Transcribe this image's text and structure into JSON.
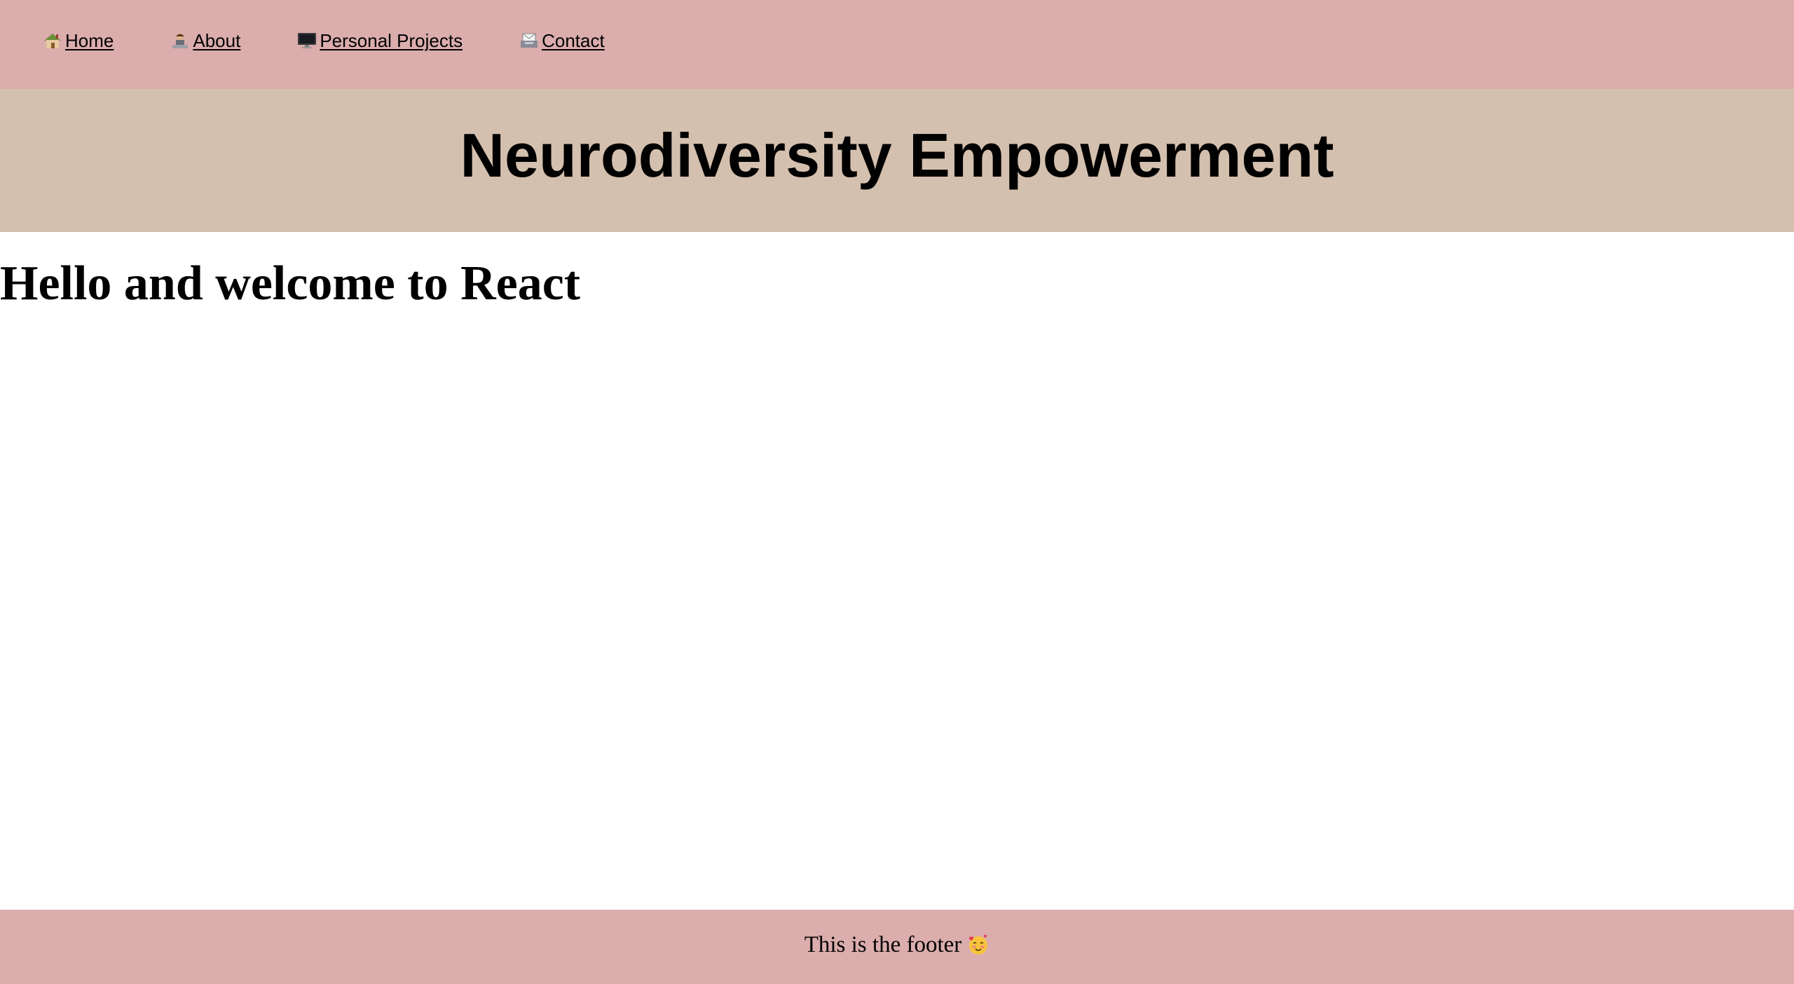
{
  "nav": {
    "items": [
      {
        "icon": "house-icon",
        "label": "Home"
      },
      {
        "icon": "person-at-desk-icon",
        "label": "About"
      },
      {
        "icon": "desktop-computer-icon",
        "label": "Personal Projects"
      },
      {
        "icon": "envelope-tray-icon",
        "label": "Contact"
      }
    ]
  },
  "banner": {
    "title": "Neurodiversity Empowerment"
  },
  "main": {
    "heading": "Hello and welcome to React"
  },
  "footer": {
    "text": "This is the footer",
    "emoji": "smiling-face-with-hearts-icon"
  },
  "colors": {
    "nav_background": "#dbadad",
    "banner_background": "#d4c0ae",
    "footer_background": "#dbadad",
    "page_background": "#ffffff",
    "text": "#000000"
  }
}
